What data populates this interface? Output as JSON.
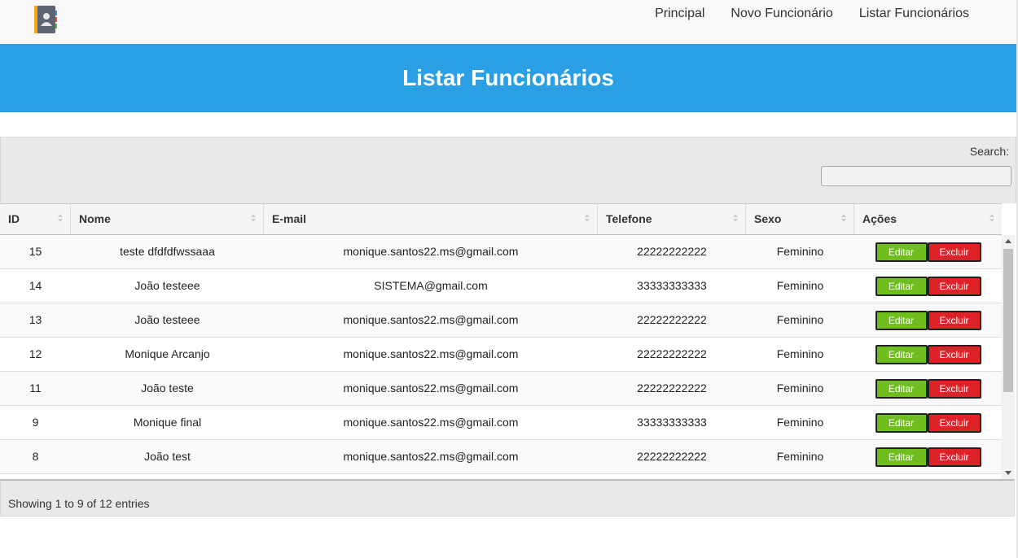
{
  "nav": {
    "links": [
      "Principal",
      "Novo Funcionário",
      "Listar Funcionários"
    ]
  },
  "banner": {
    "title": "Listar Funcionários"
  },
  "search": {
    "label": "Search:",
    "value": ""
  },
  "table": {
    "headers": [
      "ID",
      "Nome",
      "E-mail",
      "Telefone",
      "Sexo",
      "Ações"
    ],
    "rows": [
      {
        "id": "15",
        "nome": "teste dfdfdfwssaaa",
        "email": "monique.santos22.ms@gmail.com",
        "telefone": "22222222222",
        "sexo": "Feminino"
      },
      {
        "id": "14",
        "nome": "João testeee",
        "email": "SISTEMA@gmail.com",
        "telefone": "33333333333",
        "sexo": "Feminino"
      },
      {
        "id": "13",
        "nome": "João testeee",
        "email": "monique.santos22.ms@gmail.com",
        "telefone": "22222222222",
        "sexo": "Feminino"
      },
      {
        "id": "12",
        "nome": "Monique Arcanjo",
        "email": "monique.santos22.ms@gmail.com",
        "telefone": "22222222222",
        "sexo": "Feminino"
      },
      {
        "id": "11",
        "nome": "João teste",
        "email": "monique.santos22.ms@gmail.com",
        "telefone": "22222222222",
        "sexo": "Feminino"
      },
      {
        "id": "9",
        "nome": "Monique final",
        "email": "monique.santos22.ms@gmail.com",
        "telefone": "33333333333",
        "sexo": "Feminino"
      },
      {
        "id": "8",
        "nome": "João test",
        "email": "monique.santos22.ms@gmail.com",
        "telefone": "22222222222",
        "sexo": "Feminino"
      }
    ],
    "edit_label": "Editar",
    "delete_label": "Excluir"
  },
  "footer": {
    "info": "Showing 1 to 9 of 12 entries"
  },
  "colors": {
    "banner": "#2b9fe3",
    "edit_button": "#6fbe1e",
    "delete_button": "#df2128"
  },
  "icons": {
    "logo": "contact-book-icon"
  }
}
